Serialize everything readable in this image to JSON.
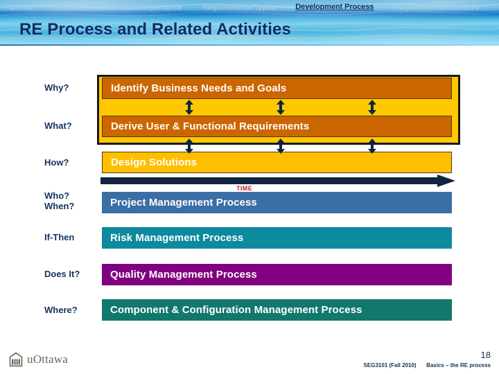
{
  "nav": {
    "items": [
      {
        "label": "Failures",
        "active": false
      },
      {
        "label": "Requirements Definition/Importance",
        "active": false
      },
      {
        "label": "Requirements Types",
        "active": false
      },
      {
        "label": "Development Process",
        "active": true
      },
      {
        "label": "Requirements Activities",
        "active": false
      }
    ]
  },
  "header": {
    "title": "RE Process and Related Activities"
  },
  "diagram": {
    "time_label": "TIME",
    "rows": [
      {
        "question": "Why?",
        "bar": "Identify Business Needs and Goals",
        "color": "#cc6600"
      },
      {
        "question": "What?",
        "bar": "Derive User & Functional Requirements",
        "color": "#cc6600"
      },
      {
        "question": "How?",
        "bar": "Design Solutions",
        "color": "#ffbf00"
      },
      {
        "question": "Who?\nWhen?",
        "bar": "Project Management Process",
        "color": "#3a6ea5"
      },
      {
        "question": "If-Then",
        "bar": "Risk Management Process",
        "color": "#0e8a9e"
      },
      {
        "question": "Does It?",
        "bar": "Quality Management Process",
        "color": "#800080"
      },
      {
        "question": "Where?",
        "bar": "Component & Configuration Management Process",
        "color": "#11786b"
      }
    ],
    "question_who": "Who?",
    "question_when": "When?"
  },
  "footer": {
    "logo_text": "uOttawa",
    "page_number": "18",
    "course": "SEG3101 (Fall 2010)",
    "subtitle": "Basics – the RE process"
  },
  "colors": {
    "accent_yellow": "#ffc800",
    "accent_orange": "#cc6600",
    "banner_blue": "#1b7fcb",
    "title_navy": "#0e2b63",
    "time_red": "#cc2222"
  }
}
